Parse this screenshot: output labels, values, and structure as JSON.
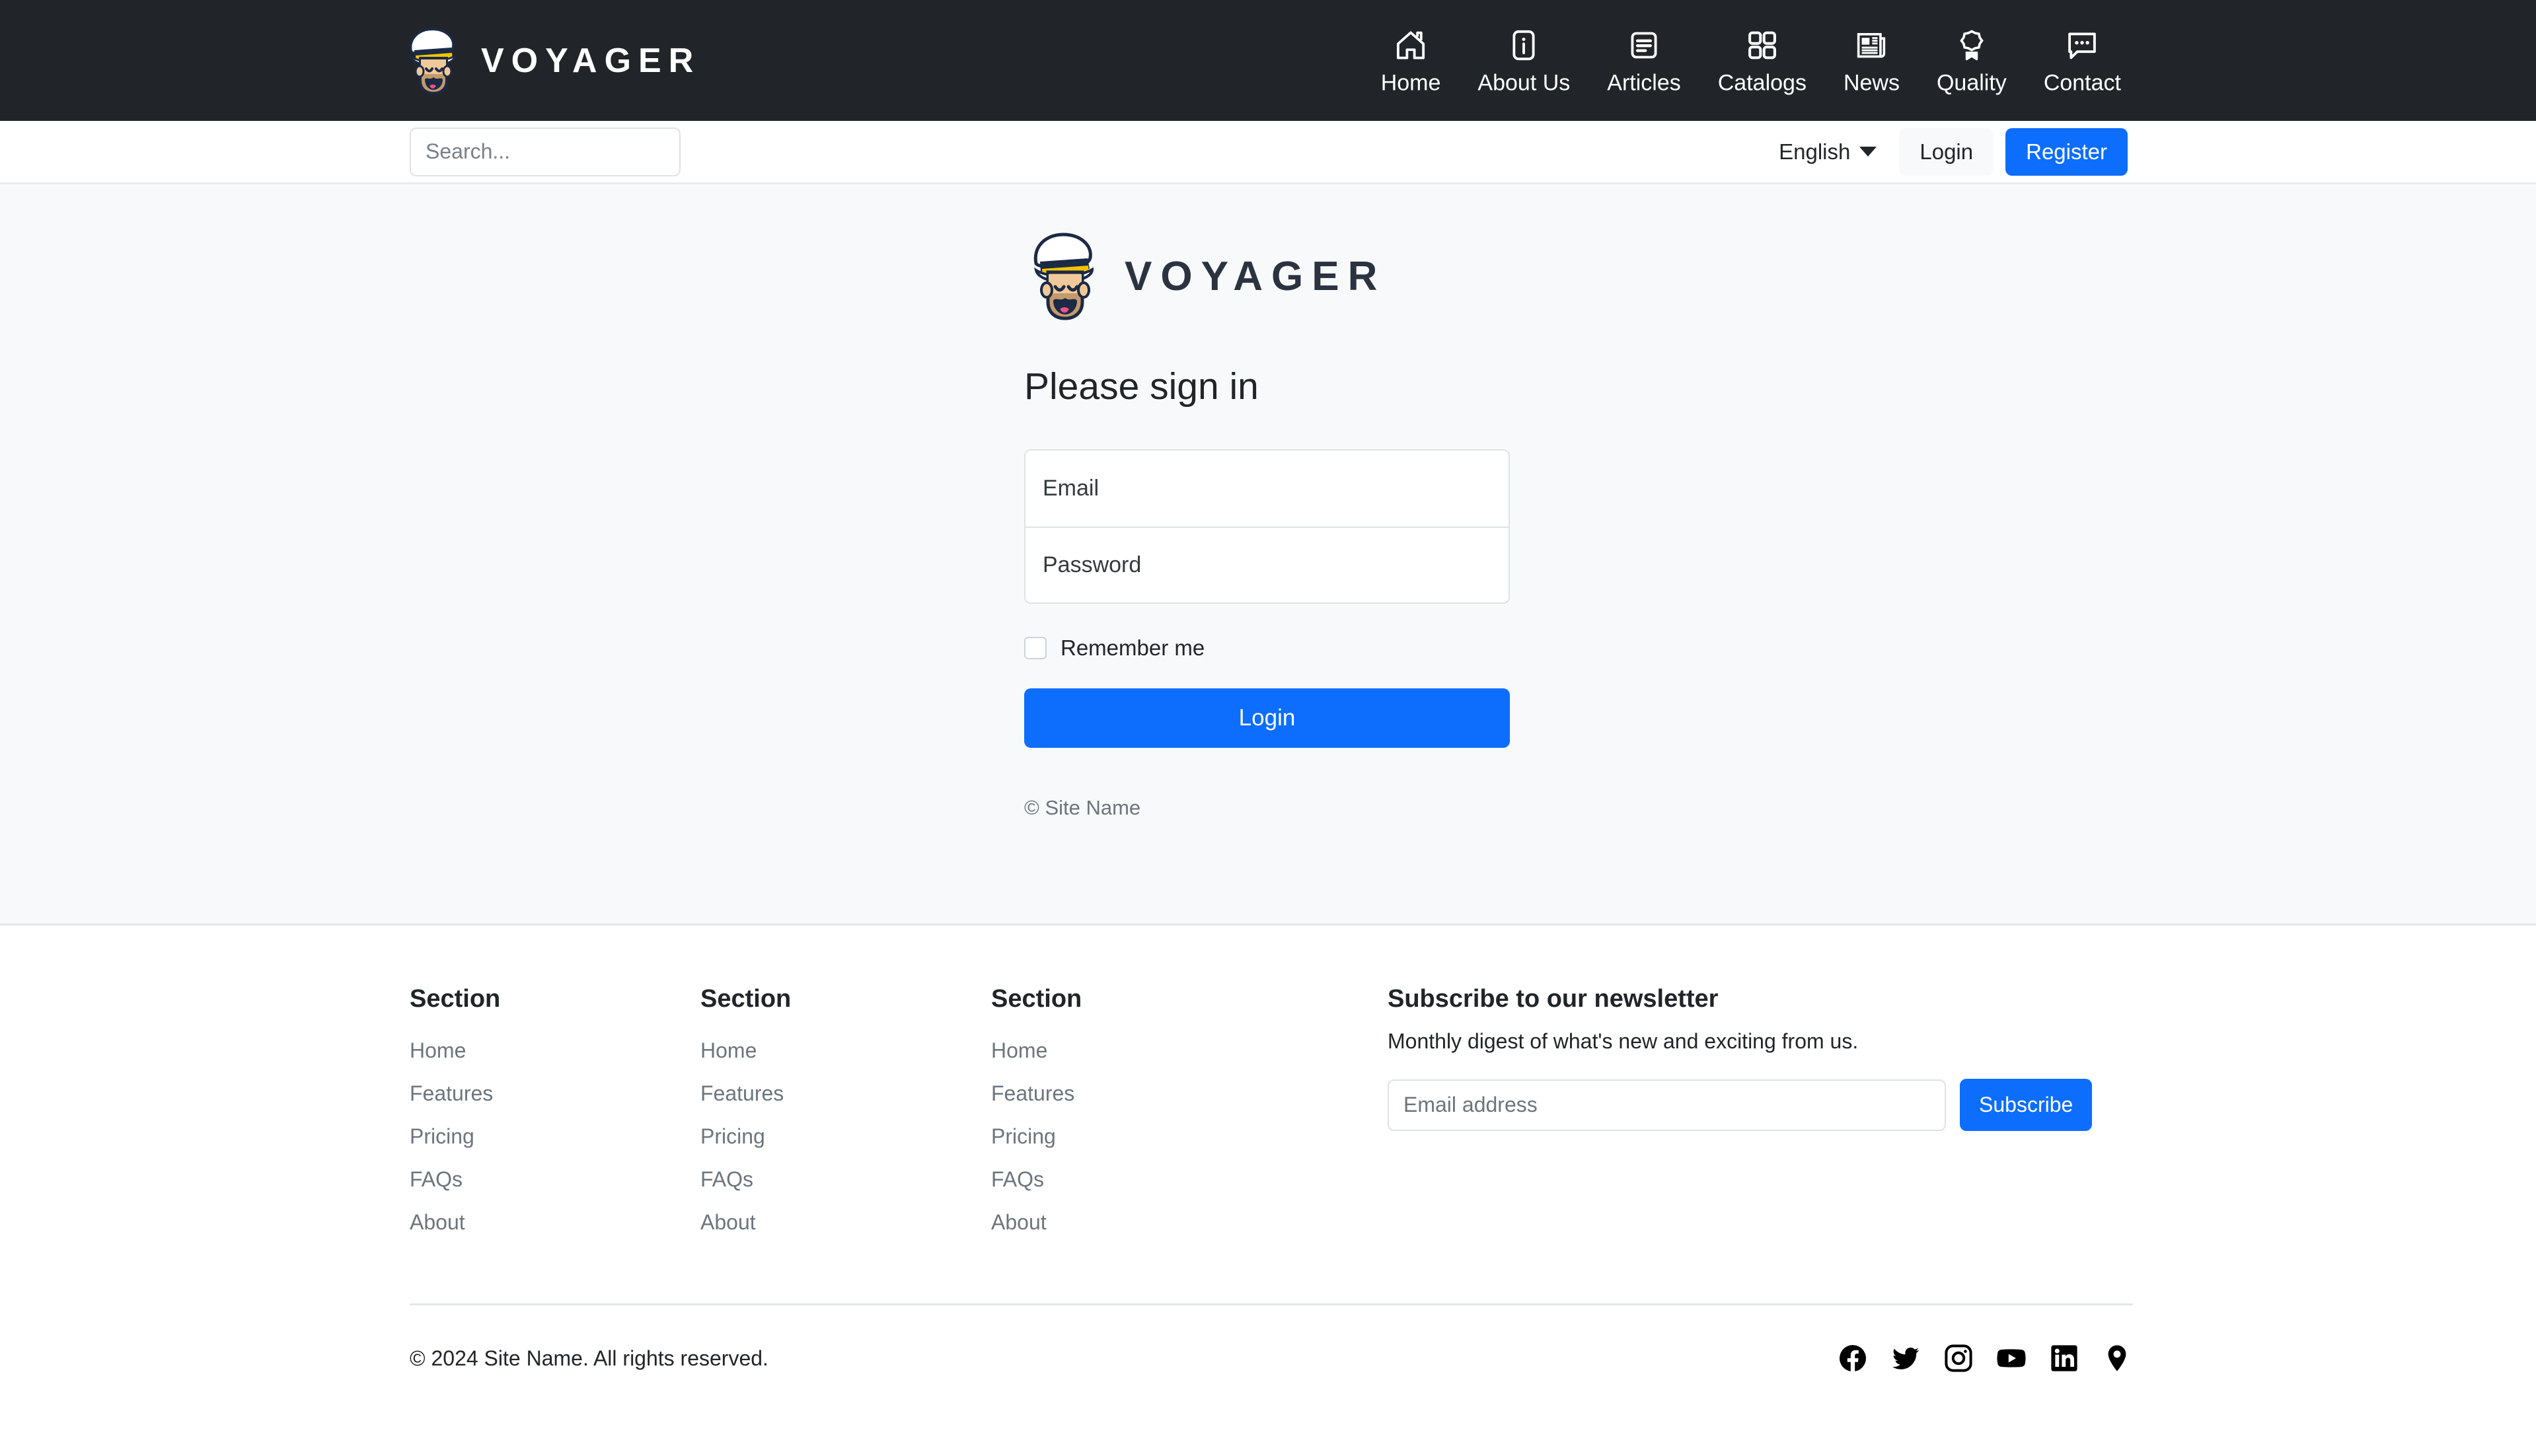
{
  "brand": {
    "name": "VOYAGER",
    "logo_icon": "sailor-captain-avatar-icon"
  },
  "topnav": {
    "background": "#212529",
    "items": [
      {
        "label": "Home",
        "icon": "house-icon"
      },
      {
        "label": "About Us",
        "icon": "info-square-icon"
      },
      {
        "label": "Articles",
        "icon": "article-lines-icon"
      },
      {
        "label": "Catalogs",
        "icon": "grid-squares-icon"
      },
      {
        "label": "News",
        "icon": "newspaper-icon"
      },
      {
        "label": "Quality",
        "icon": "award-ribbon-icon"
      },
      {
        "label": "Contact",
        "icon": "chat-bubble-dots-icon"
      }
    ]
  },
  "subbar": {
    "search": {
      "placeholder": "Search...",
      "value": ""
    },
    "language": {
      "label": "English",
      "caret_icon": "chevron-down-icon"
    },
    "login_label": "Login",
    "register_label": "Register",
    "register_color": "#0d6efd"
  },
  "main": {
    "background": "#f8f9fa",
    "logo_word": "VOYAGER",
    "title": "Please sign in",
    "email": {
      "placeholder": "Email",
      "value": ""
    },
    "password": {
      "placeholder": "Password",
      "value": ""
    },
    "remember_label": "Remember me",
    "remember_checked": false,
    "login_button": "Login",
    "copyright": "© Site Name"
  },
  "footer": {
    "columns": [
      {
        "heading": "Section",
        "links": [
          "Home",
          "Features",
          "Pricing",
          "FAQs",
          "About"
        ]
      },
      {
        "heading": "Section",
        "links": [
          "Home",
          "Features",
          "Pricing",
          "FAQs",
          "About"
        ]
      },
      {
        "heading": "Section",
        "links": [
          "Home",
          "Features",
          "Pricing",
          "FAQs",
          "About"
        ]
      }
    ],
    "newsletter": {
      "heading": "Subscribe to our newsletter",
      "subtext": "Monthly digest of what's new and exciting from us.",
      "input_placeholder": "Email address",
      "input_value": "",
      "button_label": "Subscribe"
    },
    "bottom": {
      "copyright": "© 2024 Site Name. All rights reserved.",
      "socials": [
        "facebook-icon",
        "twitter-icon",
        "instagram-icon",
        "youtube-icon",
        "linkedin-icon",
        "location-pin-icon"
      ]
    }
  }
}
